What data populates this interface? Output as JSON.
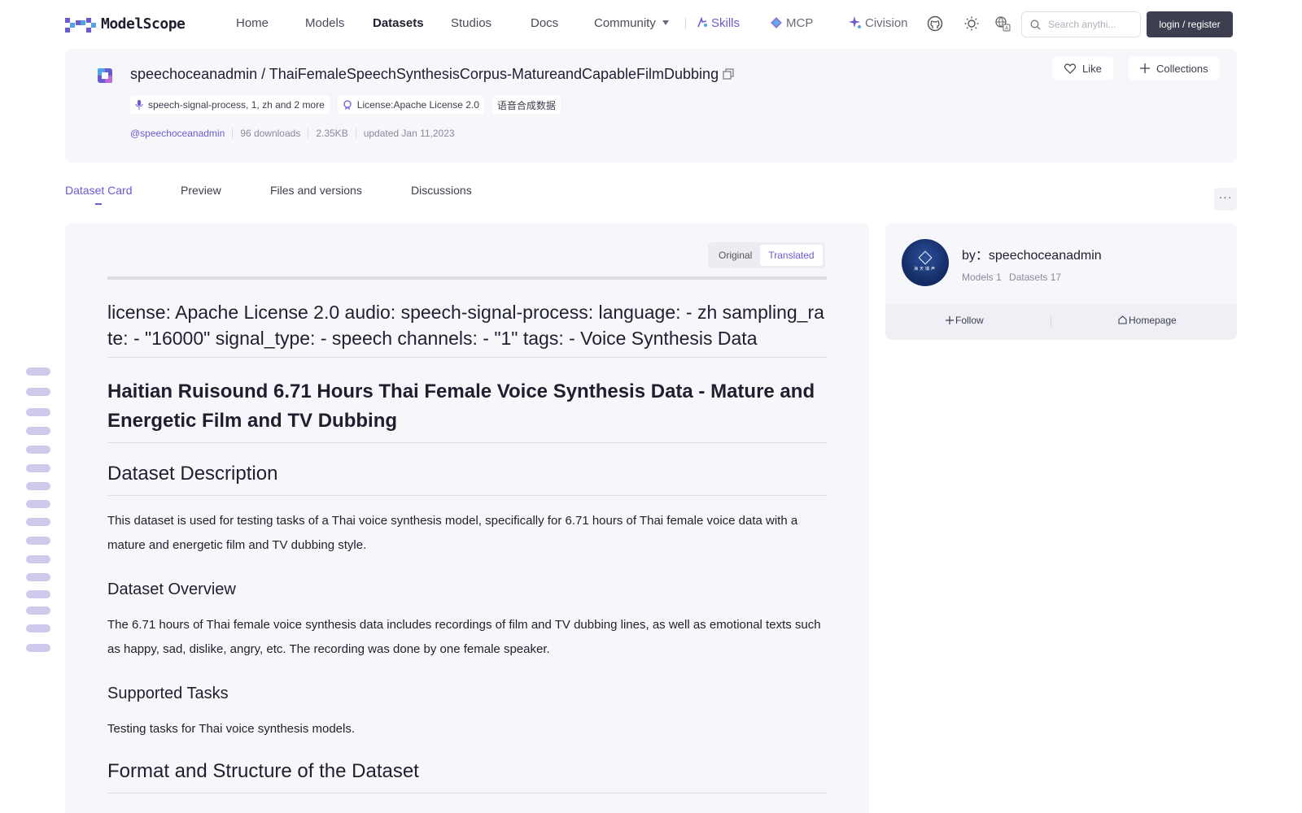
{
  "brand": {
    "name": "ModelScope",
    "accent": "#6b5bd1"
  },
  "nav": {
    "home": "Home",
    "models": "Models",
    "datasets": "Datasets",
    "studios": "Studios",
    "docs": "Docs",
    "community": "Community",
    "skills": "Skills",
    "mcp": "MCP",
    "civision": "Civision",
    "search_placeholder": "Search anythi...",
    "login": "login / register"
  },
  "repo": {
    "owner": "speechoceanadmin",
    "name": "ThaiFemaleSpeechSynthesisCorpus-MatureandCapableFilmDubbing",
    "title": "speechoceanadmin / ThaiFemaleSpeechSynthesisCorpus-MatureandCapableFilmDubbing",
    "tags": {
      "task": "speech-signal-process, 1, zh and 2 more",
      "license": "License:Apache License 2.0",
      "category": "语音合成数据"
    },
    "meta": {
      "author": "@speechoceanadmin",
      "downloads": "96 downloads",
      "size": "2.35KB",
      "updated": "updated Jan 11,2023"
    },
    "like": "Like",
    "collections": "Collections"
  },
  "tabs": {
    "card": "Dataset Card",
    "preview": "Preview",
    "files": "Files and versions",
    "discussions": "Discussions",
    "more": "···"
  },
  "content": {
    "toggle_original": "Original",
    "toggle_translated": "Translated",
    "yaml": "license: Apache License 2.0 audio: speech-signal-process: language: - zh sampling_rate: - \"16000\" signal_type: - speech channels: - \"1\" tags: - Voice Synthesis Data",
    "title": "Haitian Ruisound 6.71 Hours Thai Female Voice Synthesis Data - Mature and Energetic Film and TV Dubbing",
    "desc_heading": "Dataset Description",
    "desc_text": "This dataset is used for testing tasks of a Thai voice synthesis model, specifically for 6.71 hours of Thai female voice data with a mature and energetic film and TV dubbing style.",
    "overview_heading": "Dataset Overview",
    "overview_text": "The 6.71 hours of Thai female voice synthesis data includes recordings of film and TV dubbing lines, as well as emotional texts such as happy, sad, dislike, angry, etc. The recording was done by one female speaker.",
    "tasks_heading": "Supported Tasks",
    "tasks_text": "Testing tasks for Thai voice synthesis models.",
    "format_heading": "Format and Structure of the Dataset"
  },
  "author_card": {
    "name": "by：speechoceanadmin",
    "models": "Models 1",
    "datasets": "Datasets 17",
    "follow": "Follow",
    "homepage": "Homepage",
    "avatar_text": "海天瑞声"
  }
}
